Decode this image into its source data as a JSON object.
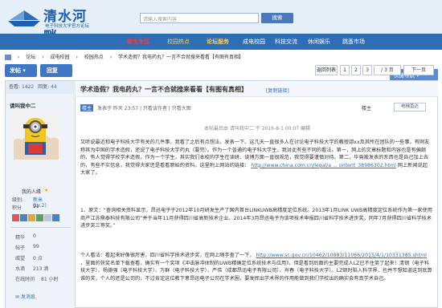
{
  "header": {
    "logo_title": "清水河畔",
    "logo_sub": "电子科技大学官方论坛",
    "search_placeholder": "请输入搜索内容",
    "search_button": "搜索"
  },
  "nav": {
    "items": [
      "新生专区",
      "校园热点",
      "论坛服务",
      "成电校园",
      "科技交流",
      "休闲娱乐",
      "跳蚤市场"
    ],
    "quick_nav": "快捷导航 ▾"
  },
  "breadcrumb": {
    "items": [
      "论坛",
      "成电校园",
      "校园热点",
      "学术造假？我电药丸？一言不合就搜来看看【有图有真相】"
    ],
    "sep": "›"
  },
  "actions": {
    "post": "发帖 ▾",
    "reply": "回复",
    "return": "返回列表",
    "pages": [
      "1",
      "2",
      "3",
      "/ 3 页",
      "下一页"
    ]
  },
  "user": {
    "views_label": "查看:",
    "views": "1422",
    "replies_label": "回复:",
    "replies": "44",
    "name": "请叫我中二",
    "title": "我的人缘",
    "stars": "★",
    "level_label": "级别:",
    "level": "新米 (Lv.2)",
    "points_label": "积分",
    "points": "91",
    "stats": [
      {
        "label": "精华",
        "value": "0"
      },
      {
        "label": "帖子",
        "value": "99"
      },
      {
        "label": "威望",
        "value": "0 点"
      },
      {
        "label": "水滴",
        "value": "213 滴"
      },
      {
        "label": "在线时间",
        "value": "81 小时"
      }
    ],
    "send_msg": "发消息"
  },
  "post": {
    "title": "学术造假？我电药丸？一言不合就搜来看看【有图有真相】",
    "copy_link": "[复制链接]",
    "author_tag": "楼主",
    "meta": "发表于 昨天 23:57  |  只看该作者  |  只看大图",
    "floor_label": "楼主",
    "jump": "电梯直达",
    "edited": "本帖最后由 请叫我中二 于 2016-8-1 00:07 编辑",
    "p1": "又听说最近和电子科技大学有关的几件事，我看了之后有点想法，发表一下。这几天一直很多人在讨论电子科技大学的教授邵xx及其所在团队的一些事，有网友称其为中国的学术造假，还说了电子科技大学药丸（要完）。作为一个普通的电子科大学生，我对此有些不同的看法。第一，网上的文章标题和内容也是有偏颇的，有人觉得学校学术造假，作为一个学生，其实我们本校的学生在读研、读博方面一直很规范，我觉得要谨慎对待。第二，毕竟被发表的东西也是自己加上去的，有些不实信息，我觉得大家还是看看原始的资料。这里附上网站的链接：",
    "p1_link": "http://www.china.com.cn/legal/a ... ontent_38986302.html",
    "p1_tail": "网上新闻说起大家了。",
    "p2": "1、原文：“查询相关资料显示，昂迅电子于2012年10月研发生产了国内首台LINKUWB高精度定位系统。2013年1月LINK UWB高精度定位系统作为第一家使用商产江苏鼎泰科技有限公司”并于当年11月获得四川省高新技术企业。2014年3月昂迅电子为该项技术申报四川省科学技术进步奖，同年7月获得四川省科学技术进步奖三等奖。”",
    "p3": "个人看法：看起来好像很厉害，四川省科学技术进步奖，在网上随手查了一下，",
    "p3_link": "http://www.sc.gov.cn/10462/10883/11066/2015/4/1/10331385.shtml",
    "p3_tail": "，里面的获奖名单下载查看，确实有一个奖项《冲击脉冲体制的UWB精确定位系统技术与应用》，但是看到后面的主要完成人LZ已不住笑了起来！清钢（电子科技大学）、杨德强（电子科技大学）、万群（电子科技大学）、严伟（成都昂迅电子有限公司）、肖春（电子科技大学）。LZ顿时陷入科学界，也并不想知道这到底算谁的奖，个人的还是公司的，不过肯定这位教下意昂迅电子公司在学术圈，要发挥出学术界的作用能做到我们学校出的确实会有真学术自己。"
  },
  "colors": {
    "nav_bg": "#2f6db5",
    "accent": "#3f77c4",
    "link": "#2f6db5",
    "highlight_red": "#ff3b3b",
    "highlight_yellow": "#ffd34d"
  }
}
